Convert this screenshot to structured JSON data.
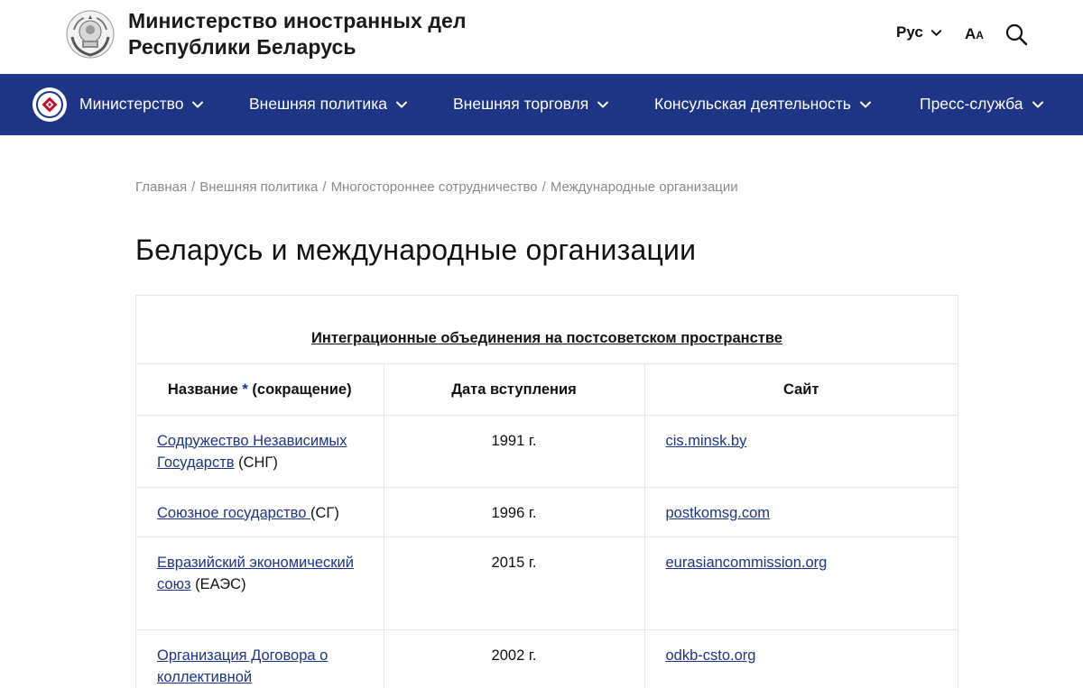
{
  "header": {
    "title_line1": "Министерство иностранных дел",
    "title_line2": "Республики Беларусь",
    "language": "Рус",
    "font_size_big": "A",
    "font_size_small": "A"
  },
  "nav": {
    "items": [
      {
        "label": "Министерство"
      },
      {
        "label": "Внешняя политика"
      },
      {
        "label": "Внешняя торговля"
      },
      {
        "label": "Консульская деятельность"
      },
      {
        "label": "Пресс-служба"
      }
    ]
  },
  "breadcrumb": [
    "Главная",
    "Внешняя политика",
    "Многостороннее сотрудничество",
    "Международные организации"
  ],
  "page_title": "Беларусь и международные организации",
  "table": {
    "caption": "Интеграционные объединения на постсоветском пространстве",
    "headers": {
      "name_prefix": "Название",
      "name_star": "*",
      "name_suffix": "(сокращение)",
      "date": "Дата вступления",
      "site": "Сайт"
    },
    "rows": [
      {
        "name": "Содружество Независимых Государств",
        "abbr": "(СНГ)",
        "date": "1991 г.",
        "site": "cis.minsk.by"
      },
      {
        "name": "Союзное государство ",
        "abbr": "(СГ)",
        "date": "1996 г.",
        "site": "postkomsg.com"
      },
      {
        "name": "Евразийский экономический союз",
        "abbr": "(ЕАЭС)",
        "date": "2015 г.",
        "site": "eurasiancommission.org"
      },
      {
        "name": "Организация Договора о коллективной",
        "abbr": "",
        "date": "2002 г.",
        "site": "odkb-csto.org"
      }
    ]
  },
  "colors": {
    "nav_background": "#1e3485",
    "link": "#1e3485",
    "breadcrumb": "#8a8a8a"
  }
}
